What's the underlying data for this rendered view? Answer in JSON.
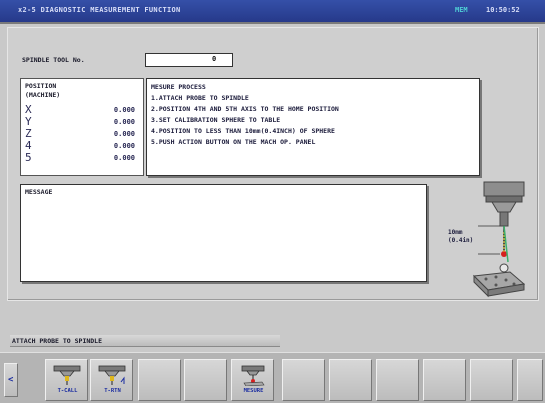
{
  "header": {
    "title": "x2-5 DIAGNOSTIC MEASUREMENT FUNCTION",
    "mode": "MEM",
    "clock": "10:50:52"
  },
  "spindle": {
    "label": "SPINDLE TOOL No.",
    "value": "0"
  },
  "position": {
    "title": "POSITION",
    "subtitle": "(MACHINE)",
    "axes": [
      {
        "axis": "X",
        "value": "0.000"
      },
      {
        "axis": "Y",
        "value": "0.000"
      },
      {
        "axis": "Z",
        "value": "0.000"
      },
      {
        "axis": "4",
        "value": "0.000"
      },
      {
        "axis": "5",
        "value": "0.000"
      }
    ]
  },
  "procedure": {
    "title": "MESURE PROCESS",
    "steps": [
      "1.ATTACH PROBE TO SPINDLE",
      "2.POSITION 4TH AND 5TH AXIS TO THE HOME POSITION",
      "3.SET CALIBRATION SPHERE TO TABLE",
      "4.POSITION TO LESS THAN 10mm(0.4INCH) OF SPHERE",
      "5.PUSH ACTION BUTTON ON THE MACH OP. PANEL"
    ]
  },
  "message": {
    "title": "MESSAGE",
    "text": ""
  },
  "illustration": {
    "dim_line1": "10mm",
    "dim_line2": "(0.4in)"
  },
  "status_line": "ATTACH PROBE TO SPINDLE",
  "softkeys": [
    {
      "label": "T-CALL",
      "icon": "probe-call-icon"
    },
    {
      "label": "T-RTN",
      "icon": "probe-return-icon"
    },
    {
      "label": "",
      "icon": ""
    },
    {
      "label": "",
      "icon": ""
    },
    {
      "label": "MESURE",
      "icon": "probe-measure-icon"
    },
    {
      "label": "",
      "icon": ""
    },
    {
      "label": "",
      "icon": ""
    },
    {
      "label": "",
      "icon": ""
    },
    {
      "label": "",
      "icon": ""
    },
    {
      "label": "",
      "icon": ""
    },
    {
      "label": "",
      "icon": ""
    }
  ],
  "back_key": "<",
  "colors": {
    "title_bar": "#26398a",
    "screen_bg": "#c9c9c9",
    "label_text": "#1a2ca0",
    "mode_text": "#4fd0d6"
  }
}
